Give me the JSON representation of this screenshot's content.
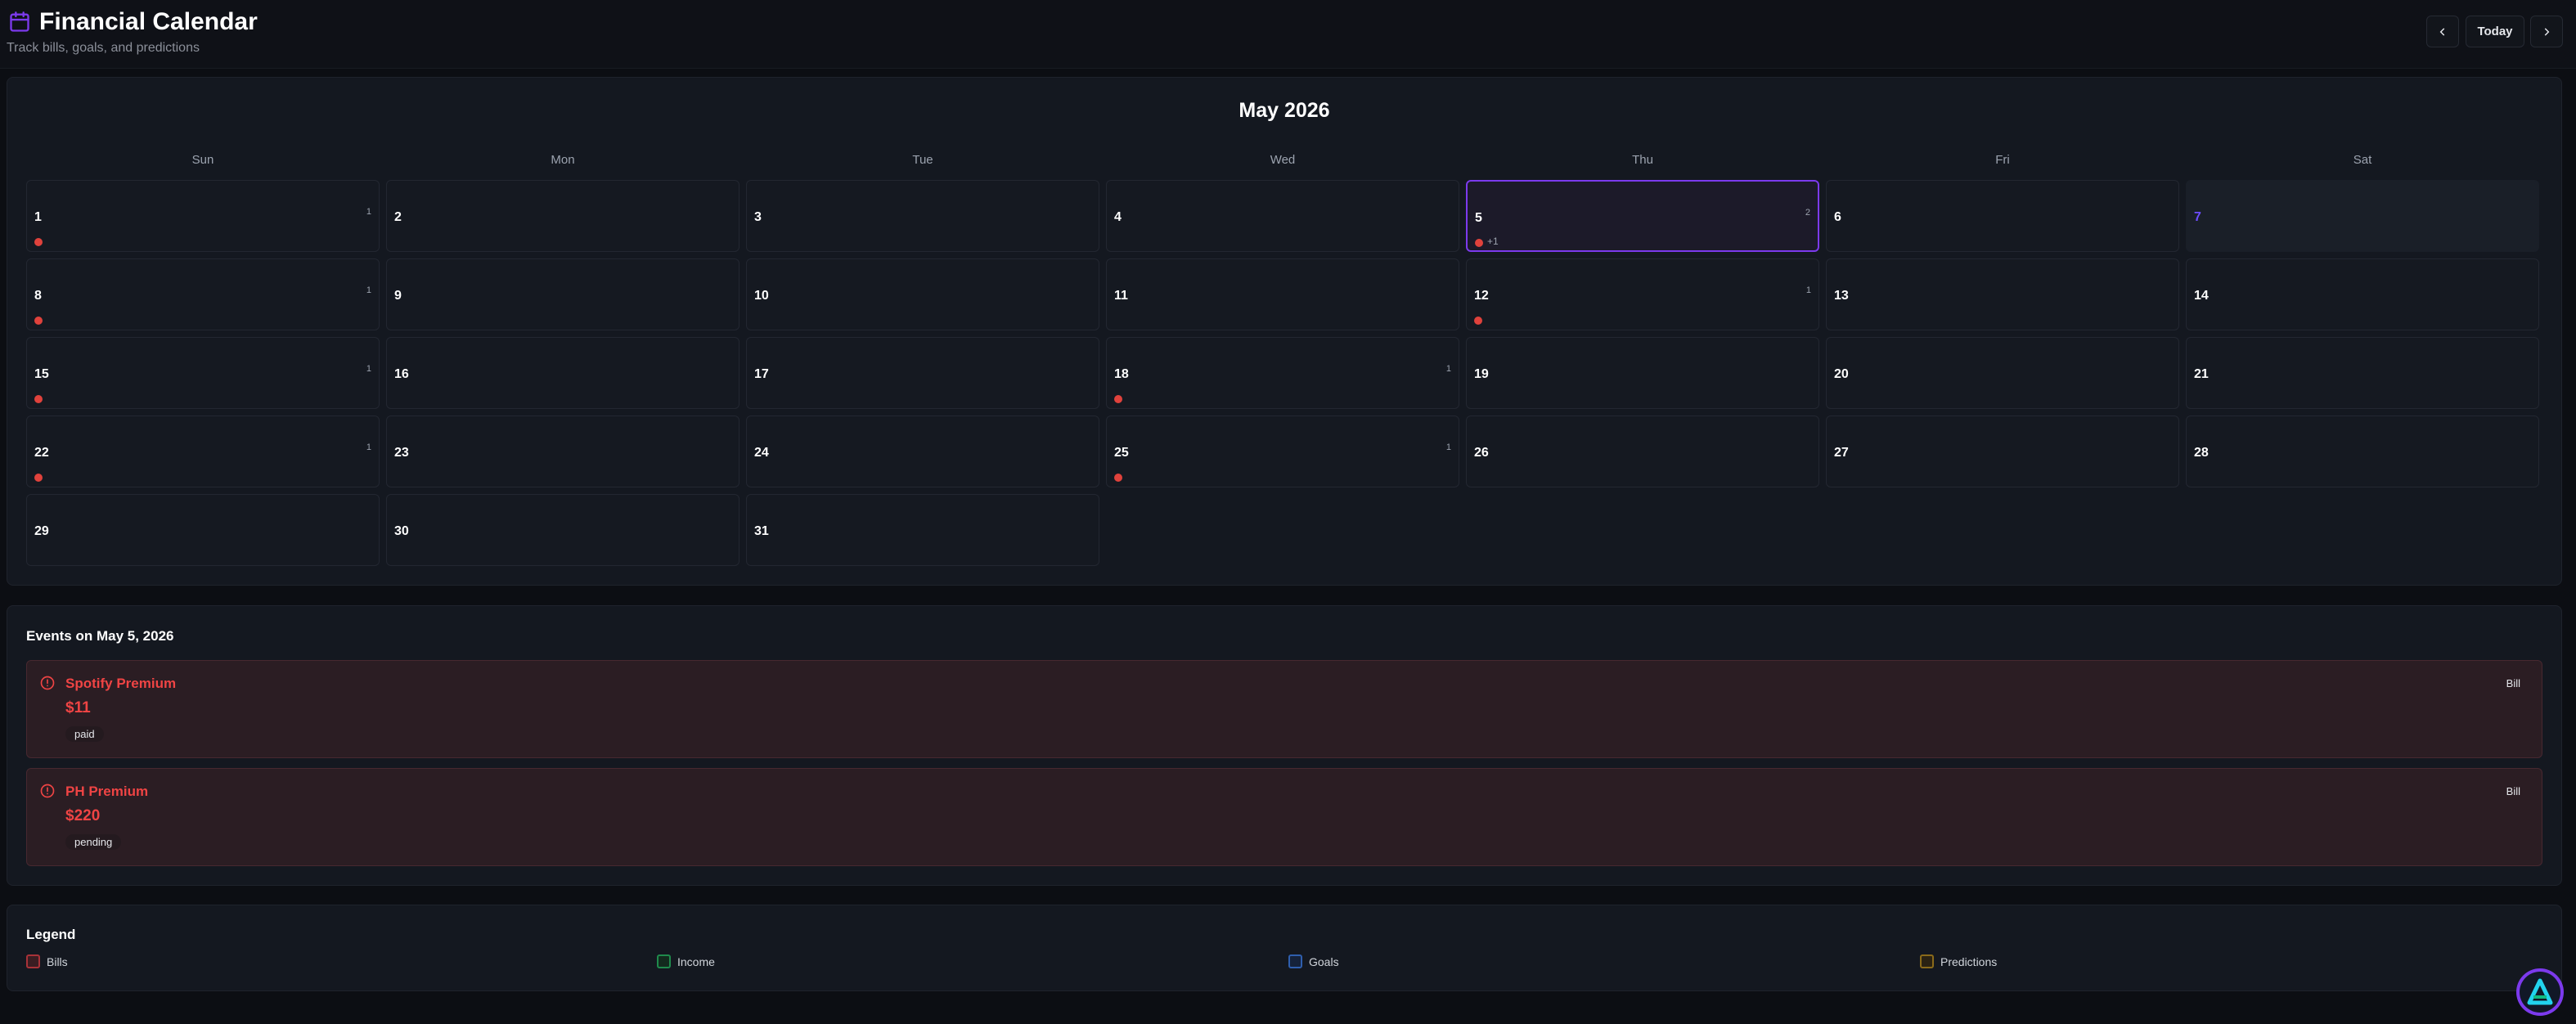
{
  "header": {
    "title": "Financial Calendar",
    "subtitle": "Track bills, goals, and predictions",
    "today_label": "Today",
    "icon": "calendar-icon"
  },
  "calendar": {
    "month_title": "May 2026",
    "weekdays": [
      "Sun",
      "Mon",
      "Tue",
      "Wed",
      "Thu",
      "Fri",
      "Sat"
    ],
    "days": [
      {
        "n": "1",
        "count": "1",
        "dot": true
      },
      {
        "n": "2"
      },
      {
        "n": "3"
      },
      {
        "n": "4"
      },
      {
        "n": "5",
        "count": "2",
        "dot": true,
        "more": "+1",
        "selected": true
      },
      {
        "n": "6"
      },
      {
        "n": "7",
        "today": true
      },
      {
        "n": "8",
        "count": "1",
        "dot": true
      },
      {
        "n": "9"
      },
      {
        "n": "10"
      },
      {
        "n": "11"
      },
      {
        "n": "12",
        "count": "1",
        "dot": true
      },
      {
        "n": "13"
      },
      {
        "n": "14"
      },
      {
        "n": "15",
        "count": "1",
        "dot": true
      },
      {
        "n": "16"
      },
      {
        "n": "17"
      },
      {
        "n": "18",
        "count": "1",
        "dot": true
      },
      {
        "n": "19"
      },
      {
        "n": "20"
      },
      {
        "n": "21"
      },
      {
        "n": "22",
        "count": "1",
        "dot": true
      },
      {
        "n": "23"
      },
      {
        "n": "24"
      },
      {
        "n": "25",
        "count": "1",
        "dot": true
      },
      {
        "n": "26"
      },
      {
        "n": "27"
      },
      {
        "n": "28"
      },
      {
        "n": "29"
      },
      {
        "n": "30"
      },
      {
        "n": "31"
      }
    ]
  },
  "events": {
    "title": "Events on May 5, 2026",
    "items": [
      {
        "name": "Spotify Premium",
        "amount": "$11",
        "status": "paid",
        "type": "Bill"
      },
      {
        "name": "PH Premium",
        "amount": "$220",
        "status": "pending",
        "type": "Bill"
      }
    ]
  },
  "legend": {
    "title": "Legend",
    "items": [
      {
        "label": "Bills",
        "border": "#a83238",
        "fill": "#3a1d22"
      },
      {
        "label": "Income",
        "border": "#1f8a4c",
        "fill": "#132a1e"
      },
      {
        "label": "Goals",
        "border": "#2f5fae",
        "fill": "#15223a"
      },
      {
        "label": "Predictions",
        "border": "#8a6a1a",
        "fill": "#2a2213"
      }
    ]
  },
  "colors": {
    "accent": "#7c3aed",
    "bill": "#ef4444",
    "dot": "#e0423c"
  }
}
